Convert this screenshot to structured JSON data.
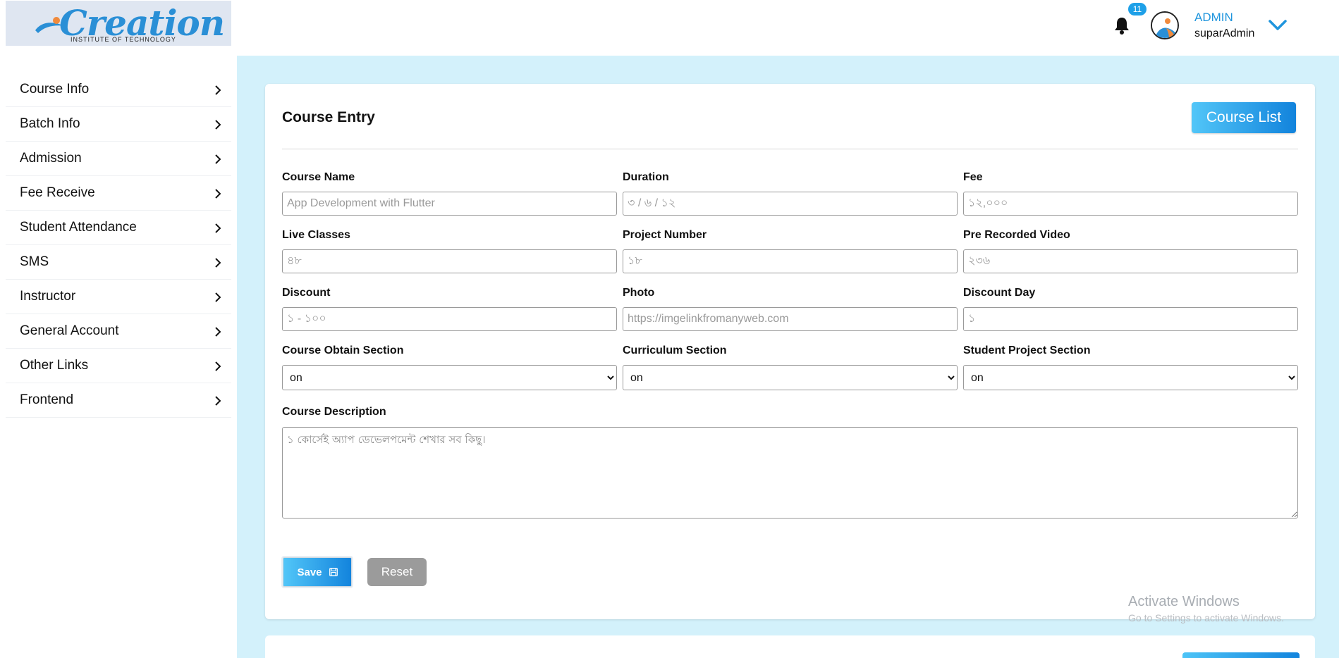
{
  "brand": {
    "name": "Creation",
    "tagline": "INSTITUTE OF TECHNOLOGY"
  },
  "header": {
    "notification_count": "11",
    "user_role": "ADMIN",
    "user_name": "suparAdmin"
  },
  "sidebar": {
    "items": [
      {
        "label": "Course Info"
      },
      {
        "label": "Batch Info"
      },
      {
        "label": "Admission"
      },
      {
        "label": "Fee Receive"
      },
      {
        "label": "Student Attendance"
      },
      {
        "label": "SMS"
      },
      {
        "label": "Instructor"
      },
      {
        "label": "General Account"
      },
      {
        "label": "Other Links"
      },
      {
        "label": "Frontend"
      }
    ]
  },
  "form": {
    "title": "Course Entry",
    "list_button": "Course List",
    "fields": {
      "course_name": {
        "label": "Course Name",
        "placeholder": "App Development with Flutter",
        "value": ""
      },
      "duration": {
        "label": "Duration",
        "placeholder": "৩ / ৬ / ১২",
        "value": ""
      },
      "fee": {
        "label": "Fee",
        "placeholder": "১২,০০০",
        "value": ""
      },
      "live_classes": {
        "label": "Live Classes",
        "placeholder": "৪৮",
        "value": ""
      },
      "project_number": {
        "label": "Project Number",
        "placeholder": "১৮",
        "value": ""
      },
      "pre_recorded_video": {
        "label": "Pre Recorded Video",
        "placeholder": "২৩৬",
        "value": ""
      },
      "discount": {
        "label": "Discount",
        "placeholder": "১ - ১০০",
        "value": ""
      },
      "photo": {
        "label": "Photo",
        "placeholder": "https://imgelinkfromanyweb.com",
        "value": ""
      },
      "discount_day": {
        "label": "Discount Day",
        "placeholder": "১",
        "value": ""
      },
      "course_obtain_section": {
        "label": "Course Obtain Section",
        "selected": "on"
      },
      "curriculum_section": {
        "label": "Curriculum Section",
        "selected": "on"
      },
      "student_project_section": {
        "label": "Student Project Section",
        "selected": "on"
      },
      "course_description": {
        "label": "Course Description",
        "placeholder": "১ কোর্সেই অ্যাপ ডেভেলপমেন্ট শেখার সব কিছু।",
        "value": ""
      }
    },
    "save_button": "Save",
    "reset_button": "Reset"
  },
  "watermark": {
    "title": "Activate Windows",
    "subtitle": "Go to Settings to activate Windows."
  },
  "colors": {
    "accent": "#1f95dd",
    "content_bg": "#d3f1fb",
    "logo_bg": "#dfe6f1",
    "reset_bg": "#9b9b9b"
  }
}
